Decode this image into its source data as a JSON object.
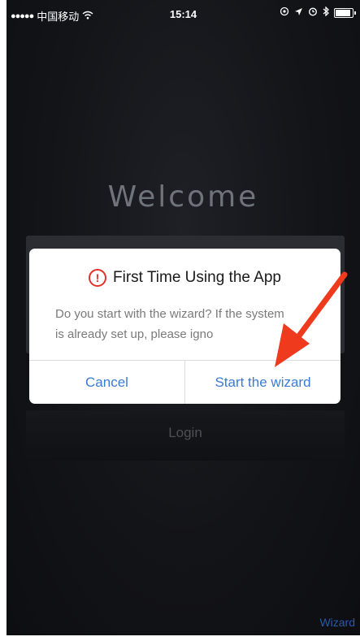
{
  "status_bar": {
    "signal": "●●●●●",
    "carrier": "中国移动",
    "wifi_icon": "wifi-icon",
    "time": "15:14"
  },
  "app": {
    "welcome_title": "Welcome",
    "login_label": "Login",
    "wizard_link": "Wizard"
  },
  "dialog": {
    "title": "First Time Using the App",
    "message": "Do you start with the wizard? If the system is already set up, please igno",
    "cancel_label": "Cancel",
    "confirm_label": "Start the wizard"
  },
  "colors": {
    "accent": "#3a7bd5",
    "alert": "#e2312c",
    "annotation_arrow": "#f03a1e"
  }
}
